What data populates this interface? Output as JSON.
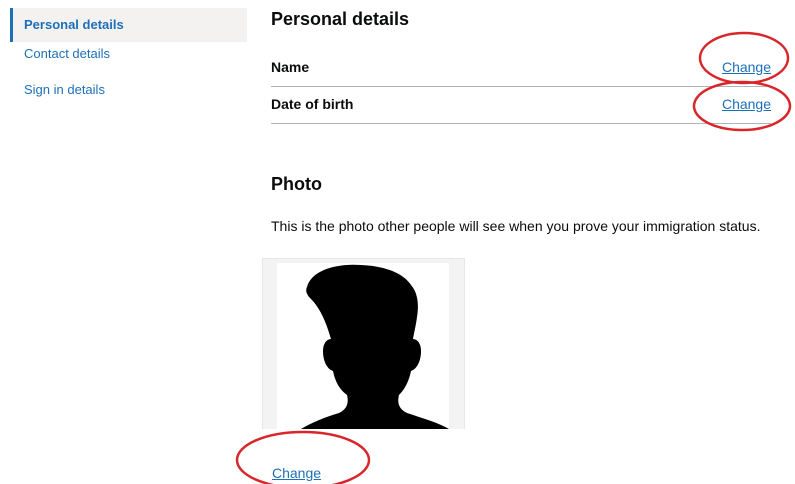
{
  "sidebar": {
    "items": [
      {
        "label": "Personal details",
        "active": true
      },
      {
        "label": "Contact details",
        "active": false
      },
      {
        "label": "Sign in details",
        "active": false
      }
    ]
  },
  "personal_details": {
    "heading": "Personal details",
    "rows": [
      {
        "key": "Name",
        "value": "",
        "action": "Change"
      },
      {
        "key": "Date of birth",
        "value": "",
        "action": "Change"
      }
    ]
  },
  "photo": {
    "heading": "Photo",
    "description": "This is the photo other people will see when you prove your immigration status.",
    "action": "Change",
    "image_icon": "person-silhouette-icon"
  },
  "annotation_color": "#d9262b",
  "link_color": "#1d70b8"
}
